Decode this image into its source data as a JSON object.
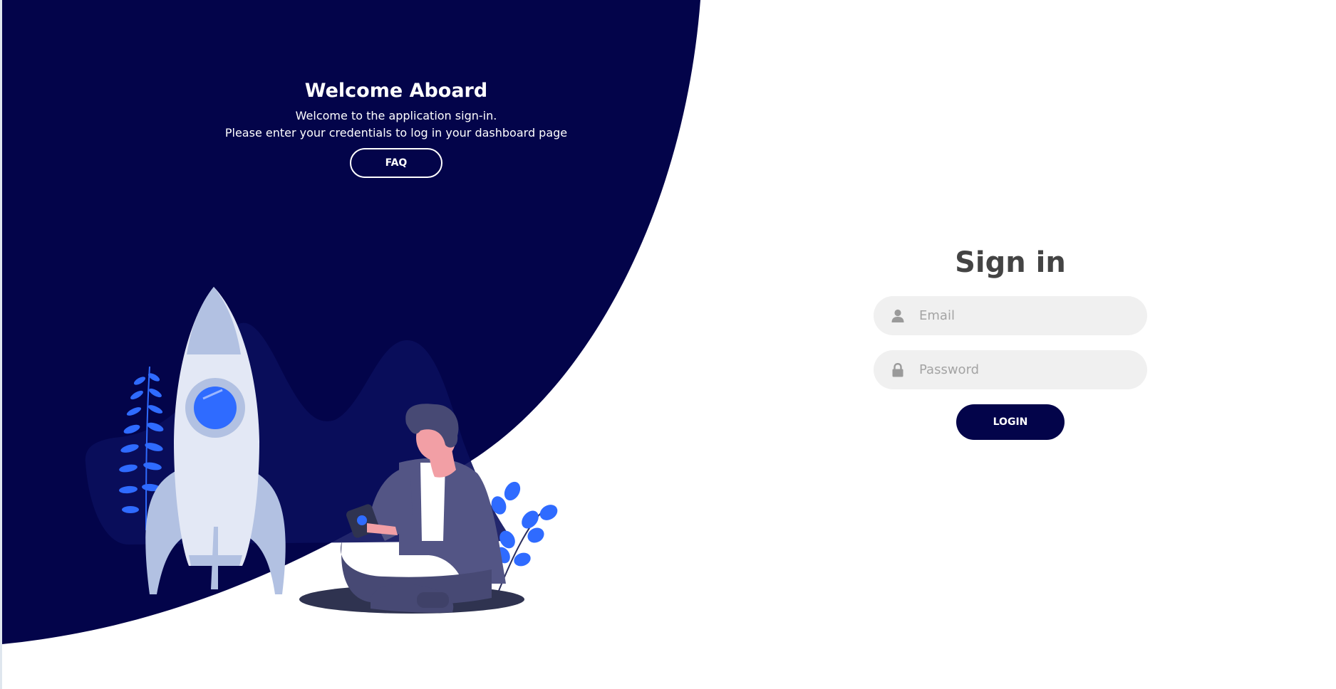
{
  "colors": {
    "panel": "#03044a",
    "accent": "#2f6bff",
    "input_bg": "#f0f0f0",
    "heading": "#444444"
  },
  "panel": {
    "title": "Welcome Aboard",
    "line1": "Welcome to the application sign-in.",
    "line2": "Please enter your credentials to log in your dashboard page",
    "faq_label": "FAQ"
  },
  "form": {
    "title": "Sign in",
    "email_placeholder": "Email",
    "email_icon": "user-icon",
    "password_placeholder": "Password",
    "password_icon": "lock-icon",
    "login_label": "LOGIN"
  }
}
